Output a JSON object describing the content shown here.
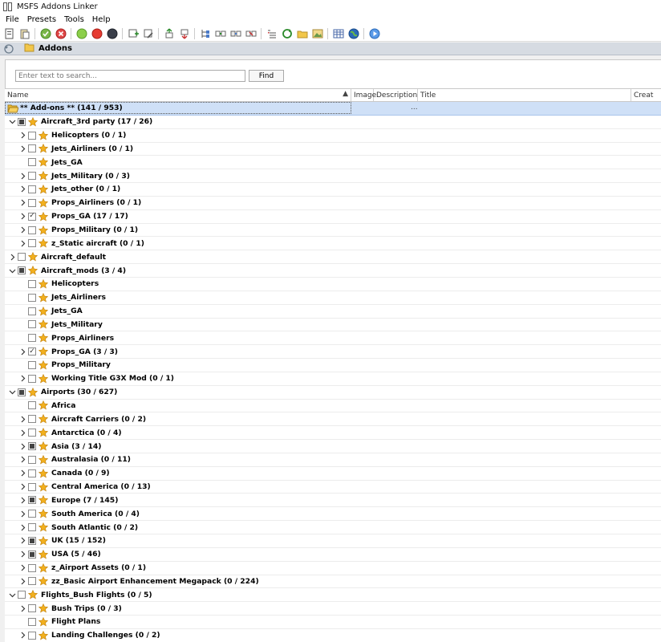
{
  "window": {
    "title": "MSFS Addons Linker"
  },
  "menu": [
    "File",
    "Presets",
    "Tools",
    "Help"
  ],
  "toolbar": {
    "icons": [
      "new-icon",
      "paste-icon",
      "check-green-icon",
      "cancel-red-icon",
      "circle-green-icon",
      "circle-red-icon",
      "circle-dark-icon",
      "add-icon",
      "edit-icon",
      "move-up-icon",
      "move-down-icon",
      "tree-icon",
      "link-icon",
      "link-alt-icon",
      "unlink-icon",
      "list-icon",
      "refresh-icon",
      "folder-icon",
      "image-icon",
      "table-icon",
      "globe-icon",
      "play-icon"
    ]
  },
  "tab": {
    "label": "Addons"
  },
  "search": {
    "placeholder": "Enter text to search...",
    "button": "Find"
  },
  "columns": {
    "name": "Name",
    "image": "Image",
    "description": "Description",
    "title": "Title",
    "created": "Creat"
  },
  "root": {
    "label": "** Add-ons ** (141 / 953)",
    "ellipsis": "..."
  },
  "rows": [
    {
      "level": 0,
      "expander": "open",
      "check": "partial",
      "label": "Aircraft_3rd party (17 / 26)"
    },
    {
      "level": 1,
      "expander": "closed",
      "check": "empty",
      "label": "Helicopters (0 / 1)"
    },
    {
      "level": 1,
      "expander": "closed",
      "check": "empty",
      "label": "Jets_Airliners (0 / 1)"
    },
    {
      "level": 1,
      "expander": "none",
      "check": "empty",
      "label": "Jets_GA"
    },
    {
      "level": 1,
      "expander": "closed",
      "check": "empty",
      "label": "Jets_Military (0 / 3)"
    },
    {
      "level": 1,
      "expander": "closed",
      "check": "empty",
      "label": "Jets_other (0 / 1)"
    },
    {
      "level": 1,
      "expander": "closed",
      "check": "empty",
      "label": "Props_Airliners (0 / 1)"
    },
    {
      "level": 1,
      "expander": "closed",
      "check": "checked",
      "label": "Props_GA (17 / 17)"
    },
    {
      "level": 1,
      "expander": "closed",
      "check": "empty",
      "label": "Props_Military (0 / 1)"
    },
    {
      "level": 1,
      "expander": "closed",
      "check": "empty",
      "label": "z_Static aircraft (0 / 1)"
    },
    {
      "level": 0,
      "expander": "closed",
      "check": "empty",
      "label": "Aircraft_default"
    },
    {
      "level": 0,
      "expander": "open",
      "check": "partial",
      "label": "Aircraft_mods (3 / 4)"
    },
    {
      "level": 1,
      "expander": "none",
      "check": "empty",
      "label": "Helicopters"
    },
    {
      "level": 1,
      "expander": "none",
      "check": "empty",
      "label": "Jets_Airliners"
    },
    {
      "level": 1,
      "expander": "none",
      "check": "empty",
      "label": "Jets_GA"
    },
    {
      "level": 1,
      "expander": "none",
      "check": "empty",
      "label": "Jets_Military"
    },
    {
      "level": 1,
      "expander": "none",
      "check": "empty",
      "label": "Props_Airliners"
    },
    {
      "level": 1,
      "expander": "closed",
      "check": "checked",
      "label": "Props_GA (3 / 3)"
    },
    {
      "level": 1,
      "expander": "none",
      "check": "empty",
      "label": "Props_Military"
    },
    {
      "level": 1,
      "expander": "closed",
      "check": "empty",
      "label": "Working Title G3X Mod (0 / 1)"
    },
    {
      "level": 0,
      "expander": "open",
      "check": "partial",
      "label": "Airports (30 / 627)"
    },
    {
      "level": 1,
      "expander": "none",
      "check": "empty",
      "label": "Africa"
    },
    {
      "level": 1,
      "expander": "closed",
      "check": "empty",
      "label": "Aircraft Carriers (0 / 2)"
    },
    {
      "level": 1,
      "expander": "closed",
      "check": "empty",
      "label": "Antarctica (0 / 4)"
    },
    {
      "level": 1,
      "expander": "closed",
      "check": "partial",
      "label": "Asia (3 / 14)"
    },
    {
      "level": 1,
      "expander": "closed",
      "check": "empty",
      "label": "Australasia (0 / 11)"
    },
    {
      "level": 1,
      "expander": "closed",
      "check": "empty",
      "label": "Canada (0 / 9)"
    },
    {
      "level": 1,
      "expander": "closed",
      "check": "empty",
      "label": "Central America (0 / 13)"
    },
    {
      "level": 1,
      "expander": "closed",
      "check": "partial",
      "label": "Europe (7 / 145)"
    },
    {
      "level": 1,
      "expander": "closed",
      "check": "empty",
      "label": "South America (0 / 4)"
    },
    {
      "level": 1,
      "expander": "closed",
      "check": "empty",
      "label": "South Atlantic (0 / 2)"
    },
    {
      "level": 1,
      "expander": "closed",
      "check": "partial",
      "label": "UK (15 / 152)"
    },
    {
      "level": 1,
      "expander": "closed",
      "check": "partial",
      "label": "USA (5 / 46)"
    },
    {
      "level": 1,
      "expander": "closed",
      "check": "empty",
      "label": "z_Airport Assets (0 / 1)"
    },
    {
      "level": 1,
      "expander": "closed",
      "check": "empty",
      "label": "zz_Basic Airport Enhancement Megapack (0 / 224)"
    },
    {
      "level": 0,
      "expander": "open",
      "check": "empty",
      "label": "Flights_Bush Flights (0 / 5)"
    },
    {
      "level": 1,
      "expander": "closed",
      "check": "empty",
      "label": "Bush Trips (0 / 3)"
    },
    {
      "level": 1,
      "expander": "none",
      "check": "empty",
      "label": "Flight Plans"
    },
    {
      "level": 1,
      "expander": "closed",
      "check": "empty",
      "label": "Landing Challenges (0 / 2)"
    }
  ],
  "colors": {
    "rootRow": "#cfe0f7",
    "star": "#f2b01e",
    "tabBar": "#d6dbe2"
  }
}
